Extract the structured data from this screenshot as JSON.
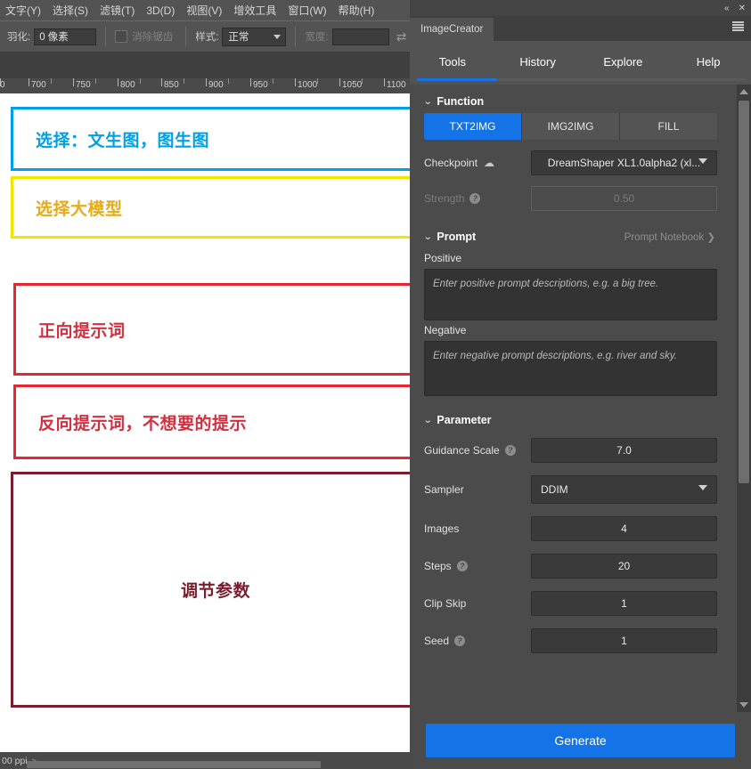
{
  "host_app": {
    "menubar": [
      "文字(Y)",
      "选择(S)",
      "滤镜(T)",
      "3D(D)",
      "视图(V)",
      "增效工具",
      "窗口(W)",
      "帮助(H)"
    ],
    "options_bar": {
      "feather_label": "羽化:",
      "feather_value": "0 像素",
      "antialias_label": "消除锯齿",
      "style_label": "样式:",
      "style_value": "正常",
      "width_label": "宽度:",
      "width_value": "",
      "swap_icon": "swap-icon"
    },
    "ruler_labels": [
      "700",
      "750",
      "800",
      "850",
      "900",
      "950",
      "1000",
      "1050",
      "1100"
    ],
    "statusbar": {
      "text": "00 ppi",
      "chevron": ">"
    }
  },
  "annotations": [
    {
      "text": "选择：文生图，图生图",
      "color": "#00a0e9"
    },
    {
      "text": "选择大模型",
      "color": "#e8ab17"
    },
    {
      "text": "正向提示词",
      "color": "#d32f3f"
    },
    {
      "text": "反向提示词，不想要的提示",
      "color": "#d32f3f"
    },
    {
      "text": "调节参数",
      "color": "#7a1d2e"
    }
  ],
  "annotation_box_colors": {
    "function": "#00a0e9",
    "checkpoint": "#f2e600",
    "positive": "#e8262f",
    "negative": "#e8262f",
    "parameter": "#7a1d2e"
  },
  "panel": {
    "titlebar": {
      "collapse_icon": "«",
      "close_icon": "✕"
    },
    "tab_label": "ImageCreator",
    "menu_icon": "hamburger-icon",
    "nav": [
      {
        "label": "Tools",
        "active": true
      },
      {
        "label": "History",
        "active": false
      },
      {
        "label": "Explore",
        "active": false
      },
      {
        "label": "Help",
        "active": false
      }
    ],
    "accent_color": "#1473e6",
    "function": {
      "title": "Function",
      "buttons": [
        {
          "label": "TXT2IMG",
          "active": true
        },
        {
          "label": "IMG2IMG",
          "active": false
        },
        {
          "label": "FILL",
          "active": false
        }
      ]
    },
    "model": {
      "checkpoint_label": "Checkpoint",
      "checkpoint_value": "DreamShaper XL1.0alpha2 (xl...",
      "strength_label": "Strength",
      "strength_value": "0.50",
      "strength_disabled": true
    },
    "prompt": {
      "title": "Prompt",
      "notebook_link": "Prompt Notebook  ❯",
      "positive_label": "Positive",
      "positive_placeholder": "Enter positive prompt descriptions, e.g. a big tree.",
      "negative_label": "Negative",
      "negative_placeholder": "Enter negative prompt descriptions, e.g. river and sky."
    },
    "parameter": {
      "title": "Parameter",
      "rows": [
        {
          "label": "Guidance Scale",
          "value": "7.0",
          "info": true,
          "type": "number"
        },
        {
          "label": "Sampler",
          "value": "DDIM",
          "info": false,
          "type": "select"
        },
        {
          "label": "Images",
          "value": "4",
          "info": false,
          "type": "number"
        },
        {
          "label": "Steps",
          "value": "20",
          "info": true,
          "type": "number"
        },
        {
          "label": "Clip Skip",
          "value": "1",
          "info": false,
          "type": "number"
        },
        {
          "label": "Seed",
          "value": "1",
          "info": true,
          "type": "number"
        }
      ]
    },
    "generate_label": "Generate"
  }
}
